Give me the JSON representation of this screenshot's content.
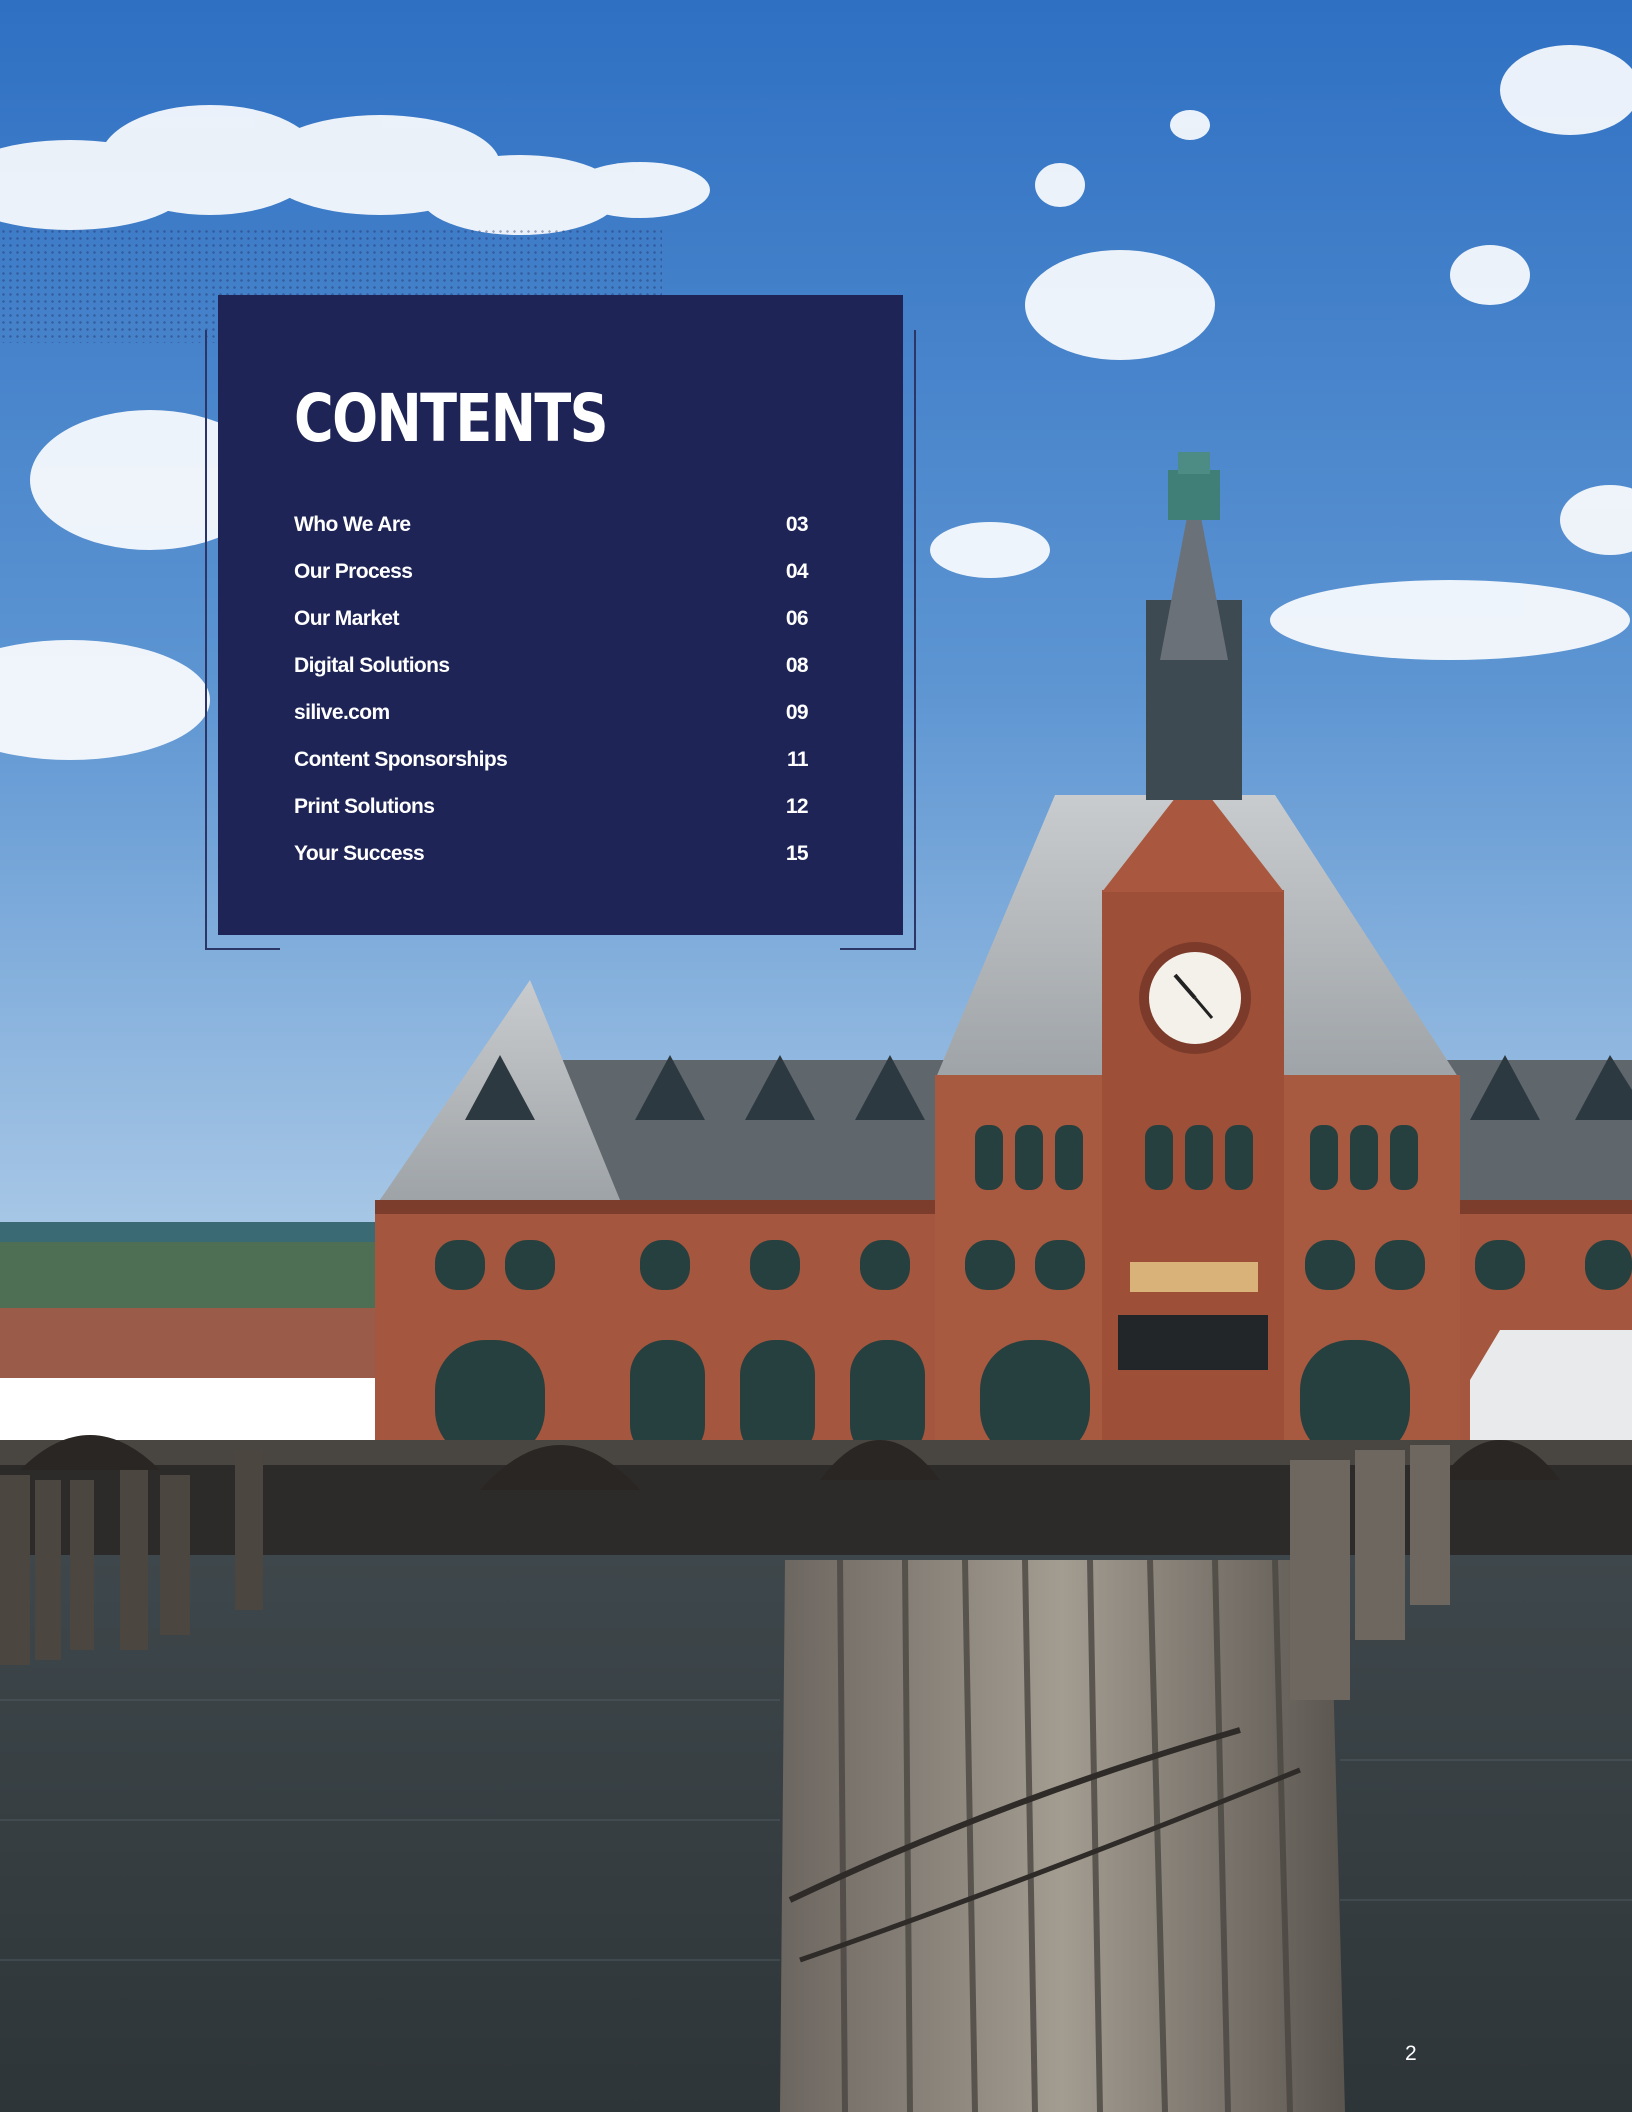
{
  "contents": {
    "title": "CONTENTS",
    "items": [
      {
        "label": "Who We Are",
        "page": "03"
      },
      {
        "label": "Our Process",
        "page": "04"
      },
      {
        "label": "Our Market",
        "page": "06"
      },
      {
        "label": "Digital Solutions",
        "page": "08"
      },
      {
        "label": "silive.com",
        "page": "09"
      },
      {
        "label": "Content Sponsorships",
        "page": "11"
      },
      {
        "label": "Print Solutions",
        "page": "12"
      },
      {
        "label": "Your Success",
        "page": "15"
      }
    ]
  },
  "page_number": "2",
  "colors": {
    "panel": "#1e2456",
    "sky_top": "#2f73c6",
    "brick": "#a4563e",
    "water": "#3b4448"
  }
}
